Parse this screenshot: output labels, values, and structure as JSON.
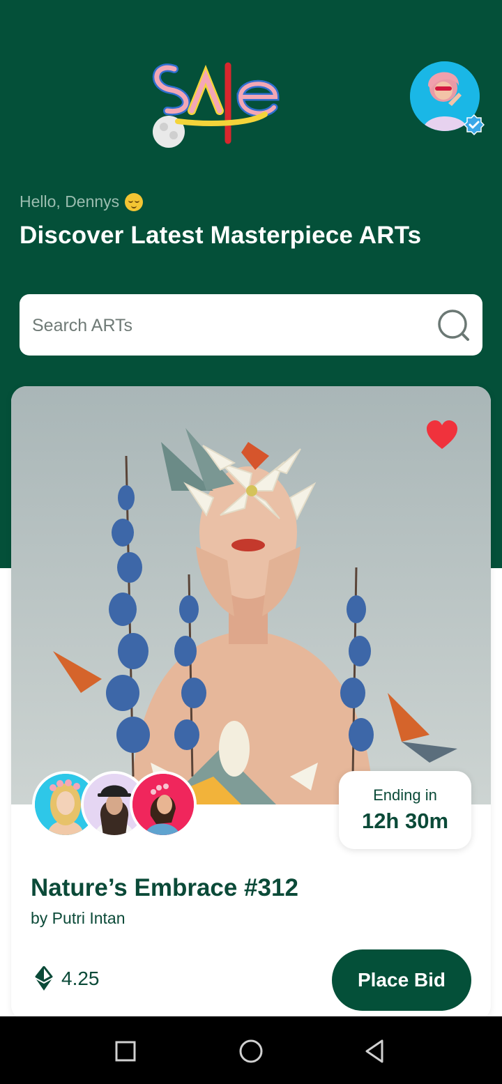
{
  "header": {
    "logo_text": "Sale",
    "greeting": "Hello, Dennys",
    "greeting_emoji": "relieved-face-emoji",
    "headline": "Discover Latest Masterpiece ARTs"
  },
  "search": {
    "placeholder": "Search ARTs",
    "value": ""
  },
  "card": {
    "favorited": true,
    "ending_label": "Ending in",
    "ending_value": "12h 30m",
    "title": "Nature’s Embrace #312",
    "artist": "by Putri Intan",
    "price": "4.25",
    "price_icon": "ethereum-icon",
    "bid_label": "Place Bid",
    "bidder_count": 3
  },
  "colors": {
    "brand_green": "#045039",
    "text_green": "#0b4a38",
    "heart_red": "#f0323c",
    "verified_blue": "#3aa8e8"
  },
  "system_nav": [
    "recents-button",
    "home-button",
    "back-button"
  ]
}
